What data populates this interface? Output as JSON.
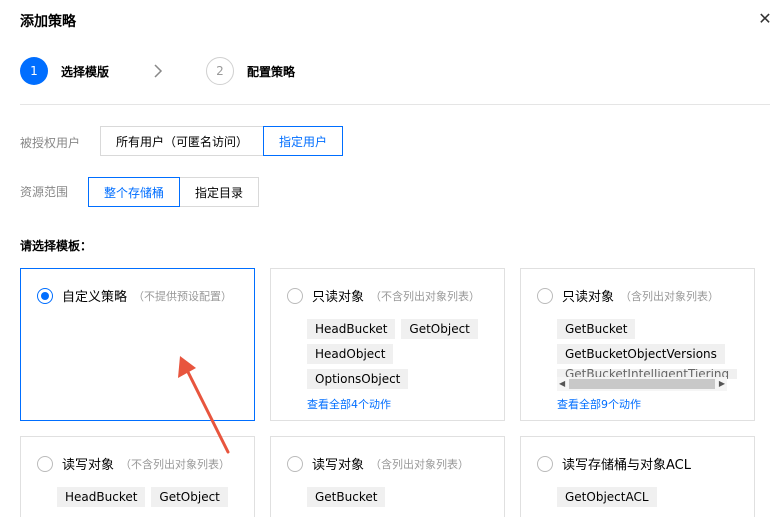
{
  "dialog": {
    "title": "添加策略",
    "close_icon": "✕"
  },
  "steps": [
    {
      "number": "1",
      "label": "选择模版",
      "active": true
    },
    {
      "number": "2",
      "label": "配置策略",
      "active": false
    }
  ],
  "authorized_users": {
    "label": "被授权用户",
    "options": [
      "所有用户（可匿名访问）",
      "指定用户"
    ],
    "selected": "指定用户"
  },
  "resource_scope": {
    "label": "资源范围",
    "options": [
      "整个存储桶",
      "指定目录"
    ],
    "selected": "整个存储桶"
  },
  "templates_title": "请选择模板：",
  "templates": [
    {
      "name": "自定义策略",
      "desc": "（不提供预设配置）",
      "selected": true,
      "tags": [],
      "view_all": ""
    },
    {
      "name": "只读对象",
      "desc": "（不含列出对象列表）",
      "selected": false,
      "tags": [
        "HeadBucket",
        "GetObject",
        "HeadObject",
        "OptionsObject"
      ],
      "view_all": "查看全部4个动作"
    },
    {
      "name": "只读对象",
      "desc": "（含列出对象列表）",
      "selected": false,
      "tags": [
        "GetBucket",
        "GetBucketObjectVersions",
        "GetBucketIntelligentTiering"
      ],
      "view_all": "查看全部9个动作"
    },
    {
      "name": "读写对象",
      "desc": "（不含列出对象列表）",
      "selected": false,
      "tags": [
        "HeadBucket",
        "GetObject"
      ],
      "view_all": ""
    },
    {
      "name": "读写对象",
      "desc": "（含列出对象列表）",
      "selected": false,
      "tags": [
        "GetBucket"
      ],
      "view_all": ""
    },
    {
      "name": "读写存储桶与对象ACL",
      "desc": "",
      "selected": false,
      "tags": [
        "GetObjectACL"
      ],
      "view_all": ""
    }
  ],
  "colors": {
    "accent": "#006eff",
    "annotation_arrow": "#e8553e"
  }
}
